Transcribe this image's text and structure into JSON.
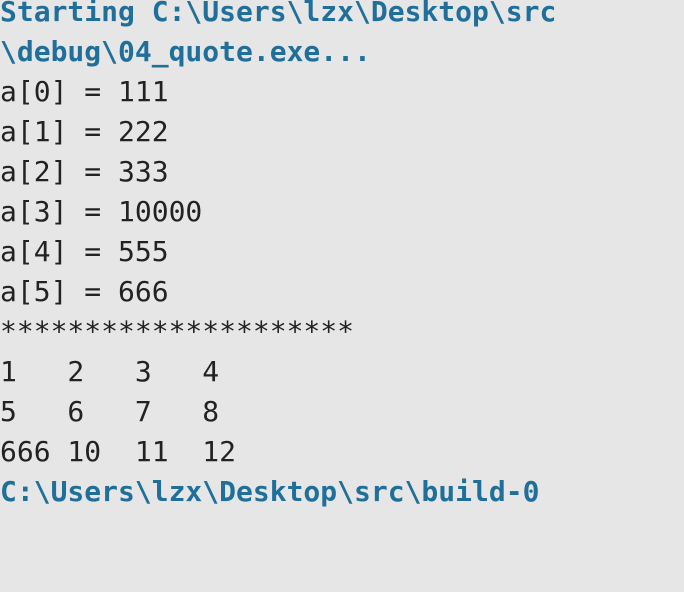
{
  "console": {
    "lines": [
      {
        "text": "Starting C:\\Users\\lzx\\Desktop\\src",
        "kind": "status"
      },
      {
        "text": "\\debug\\04_quote.exe...",
        "kind": "status"
      },
      {
        "text": "a[0] = 111",
        "kind": "output"
      },
      {
        "text": "a[1] = 222",
        "kind": "output"
      },
      {
        "text": "a[2] = 333",
        "kind": "output"
      },
      {
        "text": "a[3] = 10000",
        "kind": "output"
      },
      {
        "text": "a[4] = 555",
        "kind": "output"
      },
      {
        "text": "a[5] = 666",
        "kind": "output"
      },
      {
        "text": "*********************",
        "kind": "output"
      },
      {
        "text": "1   2   3   4",
        "kind": "output"
      },
      {
        "text": "5   6   7   8",
        "kind": "output"
      },
      {
        "text": "666 10  11  12",
        "kind": "output"
      },
      {
        "text": "C:\\Users\\lzx\\Desktop\\src\\build-0",
        "kind": "status"
      }
    ]
  },
  "colors": {
    "background": "#e6e6e6",
    "text": "#222222",
    "status": "#1f6f9a"
  }
}
